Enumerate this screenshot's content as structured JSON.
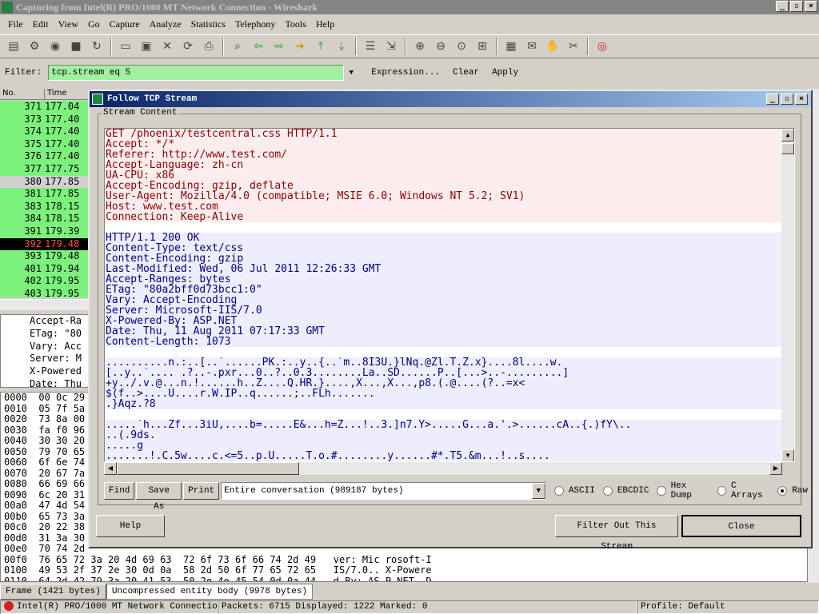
{
  "window": {
    "title": "Capturing from Intel(R) PRO/1000 MT Network Connection - Wireshark",
    "controls": [
      "_",
      "▫",
      "×"
    ]
  },
  "menu": [
    "File",
    "Edit",
    "View",
    "Go",
    "Capture",
    "Analyze",
    "Statistics",
    "Telephony",
    "Tools",
    "Help"
  ],
  "filter": {
    "label": "Filter:",
    "value": "tcp.stream eq 5",
    "expression": "Expression...",
    "clear": "Clear",
    "apply": "Apply"
  },
  "packet_list": {
    "col_no": "No.",
    "col_time": "Time",
    "rows": [
      {
        "no": "371",
        "time": "177.04",
        "style": "green"
      },
      {
        "no": "373",
        "time": "177.40",
        "style": "green"
      },
      {
        "no": "374",
        "time": "177.40",
        "style": "green"
      },
      {
        "no": "375",
        "time": "177.40",
        "style": "green"
      },
      {
        "no": "376",
        "time": "177.40",
        "style": "green"
      },
      {
        "no": "377",
        "time": "177.75",
        "style": "green"
      },
      {
        "no": "380",
        "time": "177.85",
        "style": "gray"
      },
      {
        "no": "381",
        "time": "177.85",
        "style": "green"
      },
      {
        "no": "383",
        "time": "178.15",
        "style": "green"
      },
      {
        "no": "384",
        "time": "178.15",
        "style": "green"
      },
      {
        "no": "391",
        "time": "179.39",
        "style": "green"
      },
      {
        "no": "392",
        "time": "179.48",
        "style": "sel"
      },
      {
        "no": "393",
        "time": "179.48",
        "style": "green"
      },
      {
        "no": "401",
        "time": "179.94",
        "style": "green"
      },
      {
        "no": "402",
        "time": "179.95",
        "style": "green"
      },
      {
        "no": "403",
        "time": "179.95",
        "style": "green"
      }
    ]
  },
  "details": [
    "Accept-Ra",
    "ETag: \"80",
    "Vary: Acc",
    "Server: M",
    "X-Powered",
    "Date: Thu"
  ],
  "hex": [
    "0000  00 0c 29",
    "0010  05 7f 5a",
    "0020  73 8a 00",
    "0030  fa f0 96",
    "0040  30 30 20",
    "0050  79 70 65",
    "0060  6f 6e 74",
    "0070  20 67 7a",
    "0080  66 69 66",
    "0090  6c 20 31",
    "00a0  47 4d 54",
    "00b0  65 73 3a",
    "00c0  20 22 38",
    "00d0  31 3a 30",
    "00e0  70 74 2d",
    "00f0  76 65 72 3a 20 4d 69 63  72 6f 73 6f 66 74 2d 49   ver: Mic rosoft-I",
    "0100  49 53 2f 37 2e 30 0d 0a  58 2d 50 6f 77 65 72 65   IS/7.0.. X-Powere",
    "0110  64 2d 42 79 3a 20 41 53  50 2e 4e 45 54 0d 0a 44   d-By: AS P.NET..D"
  ],
  "status_tabs": [
    "Frame (1421 bytes)",
    "Uncompressed entity body (9978 bytes)"
  ],
  "statusbar": {
    "interface": "Intel(R) PRO/1000 MT Network Connectio...",
    "packets": "Packets: 6715 Displayed: 1222 Marked: 0",
    "profile": "Profile: Default"
  },
  "dialog": {
    "title": "Follow TCP Stream",
    "group_label": "Stream Content",
    "stream_lines": [
      {
        "t": "GET /phoenix/testcentral.css HTTP/1.1",
        "k": "c"
      },
      {
        "t": "Accept: */*",
        "k": "c"
      },
      {
        "t": "Referer: http://www.test.com/",
        "k": "c"
      },
      {
        "t": "Accept-Language: zh-cn",
        "k": "c"
      },
      {
        "t": "UA-CPU: x86",
        "k": "c"
      },
      {
        "t": "Accept-Encoding: gzip, deflate",
        "k": "c"
      },
      {
        "t": "User-Agent: Mozilla/4.0 (compatible; MSIE 6.0; Windows NT 5.2; SV1)",
        "k": "c"
      },
      {
        "t": "Host: www.test.com",
        "k": "c"
      },
      {
        "t": "Connection: Keep-Alive",
        "k": "c"
      },
      {
        "t": "",
        "k": "blank"
      },
      {
        "t": "HTTP/1.1 200 OK",
        "k": "s"
      },
      {
        "t": "Content-Type: text/css",
        "k": "s"
      },
      {
        "t": "Content-Encoding: gzip",
        "k": "s"
      },
      {
        "t": "Last-Modified: Wed, 06 Jul 2011 12:26:33 GMT",
        "k": "s"
      },
      {
        "t": "Accept-Ranges: bytes",
        "k": "s"
      },
      {
        "t": "ETag: \"80a2bff0d73bcc1:0\"",
        "k": "s"
      },
      {
        "t": "Vary: Accept-Encoding",
        "k": "s"
      },
      {
        "t": "Server: Microsoft-IIS/7.0",
        "k": "s"
      },
      {
        "t": "X-Powered-By: ASP.NET",
        "k": "s"
      },
      {
        "t": "Date: Thu, 11 Aug 2011 07:17:33 GMT",
        "k": "s"
      },
      {
        "t": "Content-Length: 1073",
        "k": "s"
      },
      {
        "t": "",
        "k": "blank"
      },
      {
        "t": "..........n.:..[..`......PK.:..y..{..`m..8I3U.}lNq.@Zl.T.Z.x}....8l....w.",
        "k": "s"
      },
      {
        "t": "[..y..`.... .?..-.pxr...0..?..0.3........La..SD......P..[...>..-.........]",
        "k": "s"
      },
      {
        "t": "+y../.v.@...n.!......h..Z....Q.HR.}....,X...,X...,p8.(.@....(?..=x<",
        "k": "s"
      },
      {
        "t": "$(f..>....U....r.W.IP..q......;..FLh.......",
        "k": "s"
      },
      {
        "t": ".}Aqz.?8",
        "k": "s"
      },
      {
        "t": "",
        "k": "blank"
      },
      {
        "t": ".....`h...Zf...3iU,....b=.....E&...h=Z...!..3.]n7.Y>.....G...a.'.>......cA..{.)fY\\..",
        "k": "s"
      },
      {
        "t": "..(.9ds.",
        "k": "s"
      },
      {
        "t": ".....g",
        "k": "s"
      },
      {
        "t": ".......!.C.5w....c.<=5..p.U.....T.o.#........y......#*.T5.&m...!..s....",
        "k": "s"
      }
    ],
    "find": "Find",
    "save_as": "Save As",
    "print": "Print",
    "conversation": "Entire conversation (989187 bytes)",
    "radios": [
      {
        "label": "ASCII",
        "on": false
      },
      {
        "label": "EBCDIC",
        "on": false
      },
      {
        "label": "Hex Dump",
        "on": false
      },
      {
        "label": "C Arrays",
        "on": false
      },
      {
        "label": "Raw",
        "on": true
      }
    ],
    "help": "Help",
    "filter_out": "Filter Out This Stream",
    "close": "Close"
  }
}
